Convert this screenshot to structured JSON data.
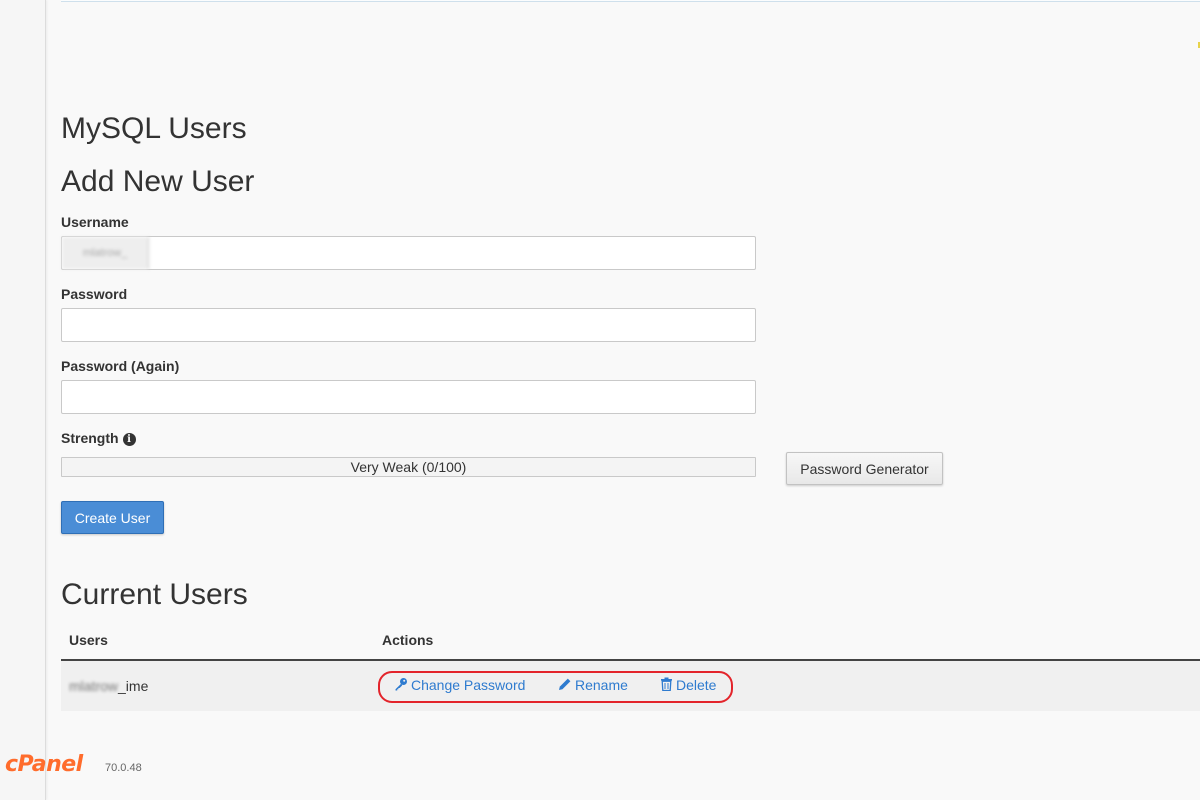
{
  "page": {
    "title": "MySQL Users"
  },
  "add_user": {
    "heading": "Add New User",
    "username_label": "Username",
    "username_prefix": "mlatrow_",
    "username_value": "",
    "password_label": "Password",
    "password_value": "",
    "password_again_label": "Password (Again)",
    "password_again_value": "",
    "strength_label": "Strength",
    "strength_text": "Very Weak (0/100)",
    "strength_fraction": 0.0,
    "generator_button": "Password Generator",
    "create_button": "Create User"
  },
  "current_users": {
    "heading": "Current Users",
    "columns": [
      "Users",
      "Actions"
    ],
    "rows": [
      {
        "user_prefix": "mlatrow",
        "user_suffix": "_ime",
        "actions": [
          "Change Password",
          "Rename",
          "Delete"
        ]
      }
    ]
  },
  "footer": {
    "logo": "cPanel",
    "version": "70.0.48"
  },
  "colors": {
    "accent": "#4a8dd6",
    "link": "#2e7bcf",
    "highlight": "#e3242b",
    "brand": "#ff6c2c"
  }
}
